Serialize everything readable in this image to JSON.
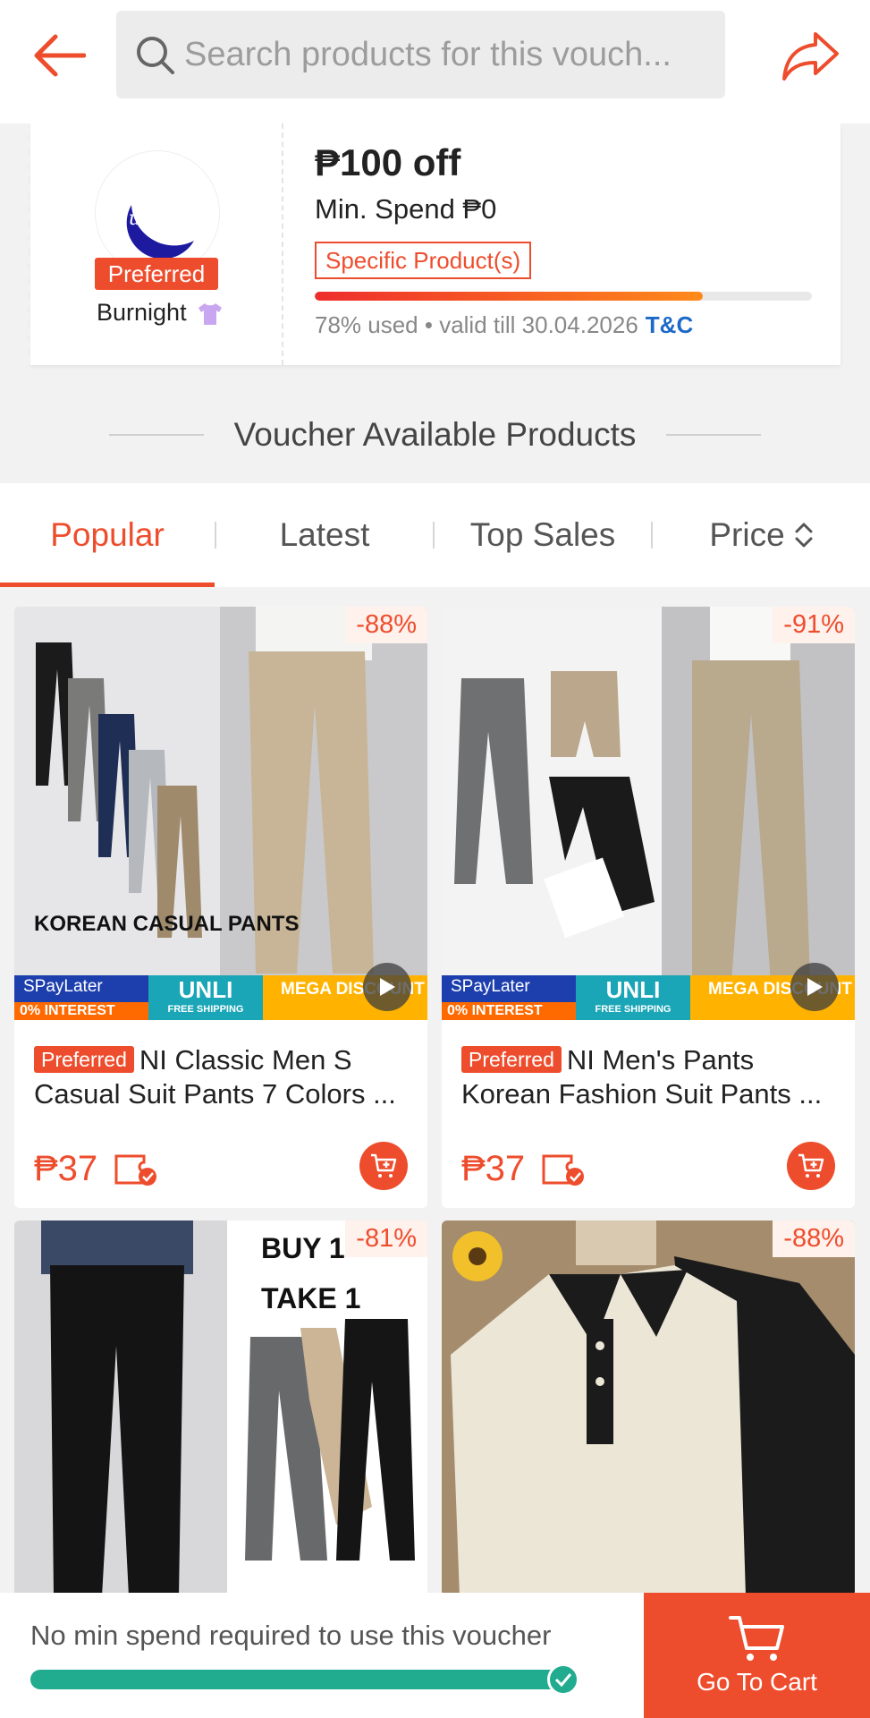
{
  "header": {
    "search_placeholder": "Search products for this vouch..."
  },
  "voucher": {
    "shop_logo_text": "Burnight",
    "preferred_label": "Preferred",
    "shop_name": "Burnight",
    "title": "₱100 off",
    "min_spend": "Min. Spend ₱0",
    "tag": "Specific Product(s)",
    "used_percent": 78,
    "usage_text": "78% used • valid till 30.04.2026",
    "tc_label": "T&C"
  },
  "section": {
    "title": "Voucher Available Products"
  },
  "tabs": [
    {
      "label": "Popular",
      "active": true
    },
    {
      "label": "Latest",
      "active": false
    },
    {
      "label": "Top Sales",
      "active": false
    },
    {
      "label": "Price",
      "active": false
    }
  ],
  "products": [
    {
      "discount": "-88%",
      "badge": "Preferred",
      "name": "NI Classic Men S Casual Suit Pants 7 Colors ...",
      "price": "₱37",
      "image_text": "KOREAN CASUAL PANTS",
      "promo": {
        "spaylater": "SPayLater",
        "interest": "0% INTEREST",
        "unli": "UNLI",
        "free": "FREE SHIPPING",
        "mega": "MEGA DISCOUNT"
      }
    },
    {
      "discount": "-91%",
      "badge": "Preferred",
      "name": "NI Men's Pants Korean Fashion Suit Pants ...",
      "price": "₱37",
      "promo": {
        "spaylater": "SPayLater",
        "interest": "0% INTEREST",
        "unli": "UNLI",
        "free": "FREE SHIPPING",
        "mega": "MEGA DISCOUNT"
      }
    },
    {
      "discount": "-81%",
      "image_text": "BUY 1 TAKE 1"
    },
    {
      "discount": "-88%"
    }
  ],
  "bottom": {
    "text": "No min spend required to use this voucher",
    "progress_percent": 100,
    "go_cart_label": "Go To Cart"
  },
  "colors": {
    "accent": "#ee4d2d",
    "link": "#1d69c8",
    "success": "#21ab8f"
  },
  "icons": [
    "back-arrow-icon",
    "search-icon",
    "share-icon",
    "tshirt-icon",
    "sort-icon",
    "play-icon",
    "voucher-icon",
    "add-to-cart-icon",
    "check-icon",
    "cart-icon"
  ]
}
